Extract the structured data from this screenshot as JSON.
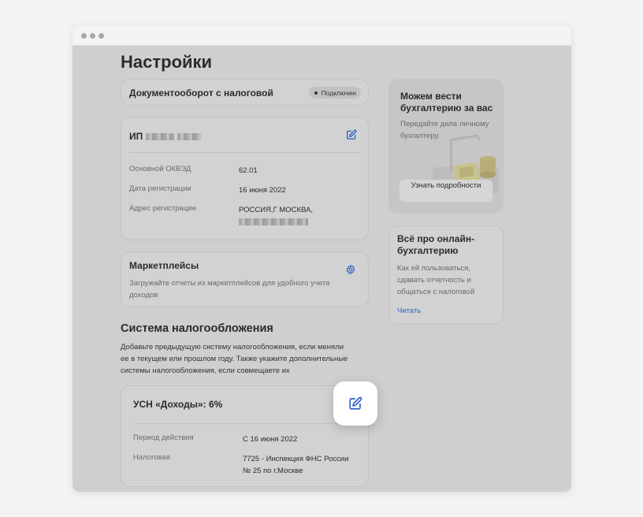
{
  "page": {
    "title": "Настройки"
  },
  "edo": {
    "title": "Документооборот с налоговой",
    "status": "Подключен"
  },
  "ip": {
    "prefix": "ИП",
    "fields": [
      {
        "label": "Основной ОКВЭД",
        "value": "62.01"
      },
      {
        "label": "Дата регистрации",
        "value": "16 июня 2022"
      },
      {
        "label": "Адрес регистрации",
        "value": "РОССИЯ,Г МОСКВА,"
      }
    ]
  },
  "marketplaces": {
    "title": "Маркетплейсы",
    "description": "Загружайте отчеты из маркетплейсов для удобного учета доходов"
  },
  "tax_system": {
    "heading": "Система налогообложения",
    "description": "Добавьте предыдущую систему налогообложения, если меняли ее в текущем или прошлом году. Также укажите дополнительные системы налогообложения, если совмещаете их",
    "regime": {
      "title": "УСН «Доходы»: 6%",
      "period_label": "Период действия",
      "period_value": "С 16 июня 2022",
      "office_label": "Налоговая",
      "office_value_1": "7725 - Инспекция ФНС России",
      "office_value_2": "№ 25 по г.Москве"
    }
  },
  "promo": {
    "title": "Можем вести бухгалтерию за вас",
    "text": "Передайте дела личному бухгалтеру.",
    "button": "Узнать подробности"
  },
  "article": {
    "title": "Всё про онлайн-бухгалтерию",
    "text": "Как ей пользоваться, сдавать отчетность и общаться с налоговой",
    "link": "Читать"
  },
  "icons": [
    "edit-icon",
    "gear-icon",
    "edit-icon"
  ],
  "colors": {
    "accent": "#2d5ec4",
    "overlay": "#cfcfcf",
    "highlight": "#ffffff"
  }
}
